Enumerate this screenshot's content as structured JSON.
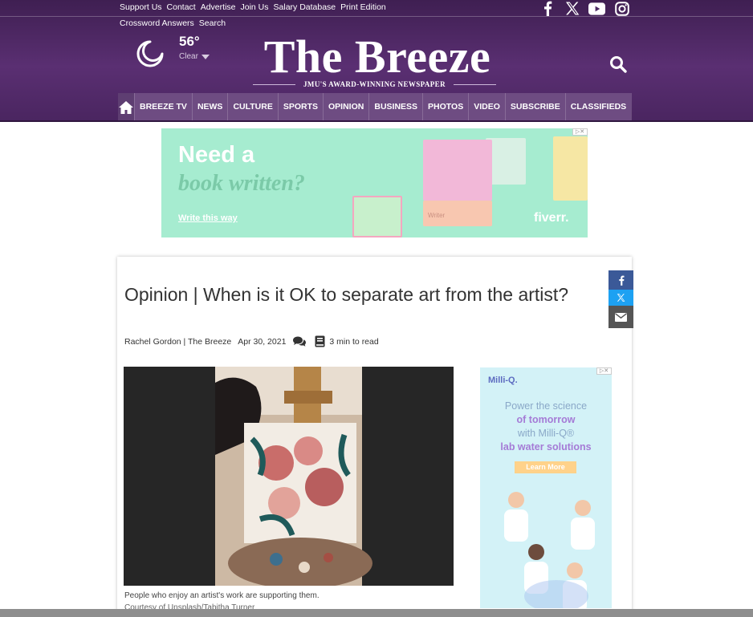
{
  "header": {
    "top_links_row1": [
      "Support Us",
      "Contact",
      "Advertise",
      "Join Us",
      "Salary Database",
      "Print Edition"
    ],
    "top_links_row2": [
      "Crossword Answers",
      "Search"
    ],
    "weather": {
      "temperature": "56°",
      "condition": "Clear"
    },
    "masthead": {
      "title": "The Breeze",
      "tagline": "JMU'S AWARD-WINNING NEWSPAPER"
    },
    "socials": [
      "facebook-icon",
      "x-icon",
      "youtube-icon",
      "instagram-icon"
    ],
    "colors": {
      "header_bg": "#4e2a64",
      "nav_bg": "#6e4c82"
    }
  },
  "nav": {
    "items": [
      "BREEZE TV",
      "NEWS",
      "CULTURE",
      "SPORTS",
      "OPINION",
      "BUSINESS",
      "PHOTOS",
      "VIDEO",
      "SUBSCRIBE",
      "CLASSIFIEDS"
    ]
  },
  "ad_top": {
    "line1": "Need a",
    "line2": "book written?",
    "cta": "Write this way",
    "brand": "fiverr.",
    "card_label": "Writer"
  },
  "article": {
    "headline": "Opinion | When is it OK to separate art from the artist?",
    "author": "Rachel Gordon | The Breeze",
    "date": "Apr 30, 2021",
    "read_time": "3 min to read",
    "caption": "People who enjoy an artist's work are supporting them.",
    "credit": "Courtesy of Unsplash/Tabitha Turner"
  },
  "share": [
    "facebook-icon",
    "x-icon",
    "email-icon"
  ],
  "ad_side": {
    "brand": "Milli-Q.",
    "line1": "Power the science",
    "line2": "of tomorrow",
    "line3": "with Milli-Q®",
    "line4": "lab water solutions",
    "cta": "Learn More"
  }
}
